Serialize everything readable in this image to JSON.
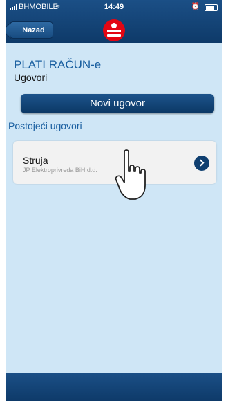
{
  "status_bar": {
    "carrier": "BHMOBILE",
    "time": "14:49"
  },
  "nav": {
    "back_label": "Nazad",
    "logo": "bank-logo-icon"
  },
  "header": {
    "title": "PLATI RAČUN-e",
    "subtitle": "Ugovori"
  },
  "main": {
    "new_contract_label": "Novi ugovor",
    "existing_heading": "Postojeći ugovori",
    "contracts": [
      {
        "name": "Struja",
        "company": "JP Elektroprivreda BiH d.d."
      }
    ]
  },
  "colors": {
    "bar": "#0e3a69",
    "background": "#cfe6f6",
    "accent_text": "#1a5fa0",
    "logo": "#e30613"
  },
  "icons": [
    "signal-icon",
    "wifi-icon",
    "alarm-icon",
    "battery-icon",
    "chevron-right-icon",
    "hand-cursor-icon"
  ]
}
